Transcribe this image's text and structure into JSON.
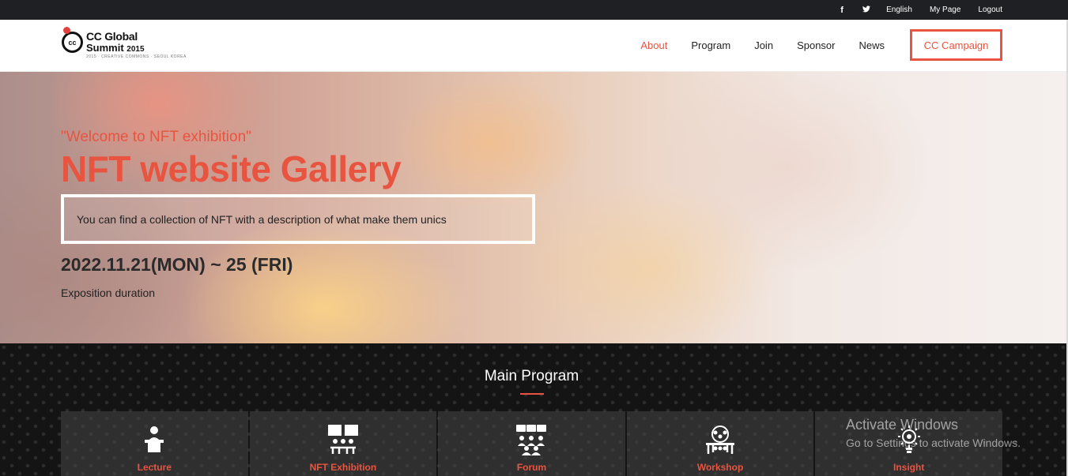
{
  "topbar": {
    "social": [
      {
        "name": "facebook-icon",
        "glyph": "f"
      },
      {
        "name": "twitter-icon",
        "glyph": "🐦"
      }
    ],
    "links": [
      "English",
      "My Page",
      "Logout"
    ]
  },
  "header": {
    "logo": {
      "mark": "cc",
      "line1": "CC Global",
      "line2": "Summit",
      "year": "2015",
      "tagline": "2015 · CREATIVE COMMONS · SEOUL KOREA"
    },
    "nav": [
      "About",
      "Program",
      "Join",
      "Sponsor",
      "News"
    ],
    "active_nav": "About",
    "cta": "CC Campaign"
  },
  "hero": {
    "kicker": "\"Welcome to NFT exhibition\"",
    "title": "NFT website Gallery",
    "description": "You can find a collection of NFT with a description of what make them unics",
    "date": "2022.11.21(MON) ~ 25 (FRI)",
    "date_caption": "Exposition duration"
  },
  "program": {
    "title": "Main Program",
    "cards": [
      {
        "label": "Lecture",
        "icon": "lecture-icon"
      },
      {
        "label": "NFT Exhibition",
        "icon": "exhibition-icon"
      },
      {
        "label": "Forum",
        "icon": "forum-icon"
      },
      {
        "label": "Workshop",
        "icon": "workshop-icon"
      },
      {
        "label": "Insight",
        "icon": "insight-icon"
      }
    ]
  },
  "watermark": {
    "line1": "Activate Windows",
    "line2": "Go to Settings to activate Windows."
  },
  "colors": {
    "accent": "#e85440",
    "topbar": "#1f2023",
    "program_bg": "#141414"
  }
}
